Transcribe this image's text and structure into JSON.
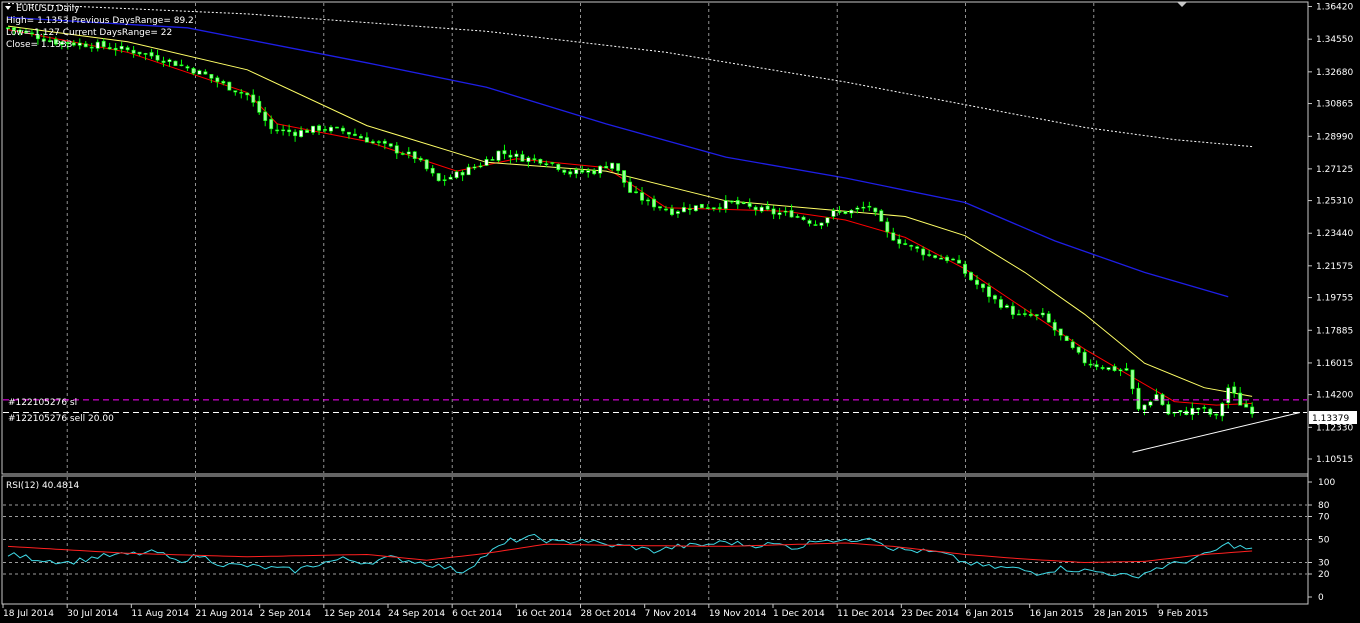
{
  "header": {
    "symbol": "EURUSD,Daily",
    "line1": "High= 1.1353 Previous DaysRange= 89.2",
    "line2": "Low= 1.127 Current DaysRange= 22",
    "line3": "Close= 1.1333"
  },
  "orders": {
    "sl_label": "#122105276 sl",
    "sell_label": "#122105276 sell 20.00",
    "sl_price": 1.139,
    "entry_price": 1.1318
  },
  "price_tag": "1.13379",
  "rsi_label": "RSI(12) 40.4814",
  "colors": {
    "background": "#000000",
    "bull_candle": "#ffffff",
    "bear_candle": "#98ff98",
    "candle_outline": "#00ff00",
    "ma_fast": "#ff0000",
    "ma_mid": "#ffff66",
    "ma_slow": "#1e1ee6",
    "ma_long": "#ffffff",
    "sl_line": "#ff00ff",
    "rsi_main": "#3fd9e6",
    "rsi_signal": "#ff2020",
    "grid": "#cfcfcf"
  },
  "chart_data": [
    {
      "type": "candlestick",
      "symbol": "EURUSD",
      "timeframe": "Daily",
      "x_labels": [
        "18 Jul 2014",
        "30 Jul 2014",
        "11 Aug 2014",
        "21 Aug 2014",
        "2 Sep 2014",
        "12 Sep 2014",
        "24 Sep 2014",
        "6 Oct 2014",
        "16 Oct 2014",
        "28 Oct 2014",
        "7 Nov 2014",
        "19 Nov 2014",
        "1 Dec 2014",
        "11 Dec 2014",
        "23 Dec 2014",
        "6 Jan 2015",
        "16 Jan 2015",
        "28 Jan 2015",
        "9 Feb 2015"
      ],
      "y_ticks": [
        "1.36420",
        "1.34550",
        "1.32680",
        "1.30865",
        "1.28990",
        "1.27125",
        "1.25310",
        "1.23440",
        "1.21575",
        "1.19755",
        "1.17885",
        "1.16015",
        "1.14200",
        "1.12330",
        "1.10515"
      ],
      "ylim": [
        1.1,
        1.3645
      ],
      "close_path": [
        [
          0,
          1.352
        ],
        [
          8,
          1.344
        ],
        [
          15,
          1.342
        ],
        [
          22,
          1.338
        ],
        [
          27,
          1.333
        ],
        [
          33,
          1.325
        ],
        [
          36,
          1.3195
        ],
        [
          40,
          1.3135
        ],
        [
          44,
          1.294
        ],
        [
          48,
          1.292
        ],
        [
          52,
          1.2945
        ],
        [
          56,
          1.293
        ],
        [
          60,
          1.288
        ],
        [
          64,
          1.283
        ],
        [
          68,
          1.278
        ],
        [
          72,
          1.264
        ],
        [
          75,
          1.268
        ],
        [
          79,
          1.274
        ],
        [
          82,
          1.281
        ],
        [
          86,
          1.2775
        ],
        [
          90,
          1.276
        ],
        [
          94,
          1.269
        ],
        [
          98,
          1.27
        ],
        [
          101,
          1.275
        ],
        [
          104,
          1.258
        ],
        [
          107,
          1.252
        ],
        [
          111,
          1.247
        ],
        [
          114,
          1.2495
        ],
        [
          118,
          1.25
        ],
        [
          121,
          1.252
        ],
        [
          124,
          1.249
        ],
        [
          128,
          1.246
        ],
        [
          131,
          1.2455
        ],
        [
          135,
          1.24
        ],
        [
          138,
          1.246
        ],
        [
          141,
          1.247
        ],
        [
          144,
          1.25
        ],
        [
          147,
          1.234
        ],
        [
          150,
          1.228
        ],
        [
          154,
          1.222
        ],
        [
          158,
          1.219
        ],
        [
          161,
          1.208
        ],
        [
          165,
          1.196
        ],
        [
          169,
          1.187
        ],
        [
          173,
          1.187
        ],
        [
          177,
          1.171
        ],
        [
          180,
          1.161
        ],
        [
          184,
          1.157
        ],
        [
          187,
          1.156
        ],
        [
          189,
          1.133
        ],
        [
          192,
          1.142
        ],
        [
          194,
          1.131
        ],
        [
          197,
          1.132
        ],
        [
          199,
          1.1345
        ],
        [
          202,
          1.129
        ],
        [
          204,
          1.146
        ],
        [
          206,
          1.137
        ],
        [
          208,
          1.133
        ]
      ],
      "indicators": [
        {
          "name": "MA fast",
          "color": "#ff0000",
          "values": [
            [
              0,
              1.351
            ],
            [
              20,
              1.338
            ],
            [
              40,
              1.315
            ],
            [
              45,
              1.297
            ],
            [
              60,
              1.287
            ],
            [
              75,
              1.27
            ],
            [
              85,
              1.277
            ],
            [
              100,
              1.272
            ],
            [
              110,
              1.249
            ],
            [
              130,
              1.247
            ],
            [
              140,
              1.242
            ],
            [
              150,
              1.232
            ],
            [
              160,
              1.214
            ],
            [
              170,
              1.191
            ],
            [
              180,
              1.168
            ],
            [
              188,
              1.152
            ],
            [
              195,
              1.138
            ],
            [
              202,
              1.136
            ],
            [
              208,
              1.137
            ]
          ]
        },
        {
          "name": "MA mid",
          "color": "#ffff66",
          "values": [
            [
              0,
              1.353
            ],
            [
              20,
              1.344
            ],
            [
              40,
              1.328
            ],
            [
              60,
              1.296
            ],
            [
              80,
              1.275
            ],
            [
              100,
              1.27
            ],
            [
              120,
              1.253
            ],
            [
              140,
              1.247
            ],
            [
              150,
              1.244
            ],
            [
              160,
              1.233
            ],
            [
              170,
              1.212
            ],
            [
              180,
              1.188
            ],
            [
              190,
              1.16
            ],
            [
              200,
              1.146
            ],
            [
              208,
              1.141
            ]
          ]
        },
        {
          "name": "MA slow",
          "color": "#1e1ee6",
          "values": [
            [
              0,
              1.358
            ],
            [
              30,
              1.352
            ],
            [
              60,
              1.332
            ],
            [
              80,
              1.318
            ],
            [
              100,
              1.297
            ],
            [
              120,
              1.278
            ],
            [
              140,
              1.266
            ],
            [
              160,
              1.252
            ],
            [
              175,
              1.23
            ],
            [
              190,
              1.212
            ],
            [
              204,
              1.198
            ]
          ]
        },
        {
          "name": "MA long",
          "color": "#ffffff",
          "values": [
            [
              0,
              1.366
            ],
            [
              40,
              1.36
            ],
            [
              80,
              1.35
            ],
            [
              110,
              1.338
            ],
            [
              140,
              1.321
            ],
            [
              160,
              1.308
            ],
            [
              180,
              1.295
            ],
            [
              195,
              1.288
            ],
            [
              208,
              1.284
            ]
          ]
        }
      ],
      "trendline": {
        "from": [
          188,
          1.109
        ],
        "to": [
          216,
          1.1318
        ]
      }
    },
    {
      "type": "line",
      "title": "RSI(12) 40.4814",
      "y_ticks": [
        "100",
        "80",
        "70",
        "50",
        "30",
        "20",
        "0"
      ],
      "ylim": [
        0,
        100
      ],
      "series": [
        {
          "name": "RSI(12)",
          "color": "#3fd9e6",
          "values": [
            [
              0,
              37
            ],
            [
              5,
              33
            ],
            [
              10,
              30
            ],
            [
              15,
              35
            ],
            [
              20,
              37
            ],
            [
              25,
              39
            ],
            [
              28,
              31
            ],
            [
              32,
              36
            ],
            [
              36,
              28
            ],
            [
              40,
              27
            ],
            [
              44,
              25
            ],
            [
              48,
              23
            ],
            [
              52,
              29
            ],
            [
              56,
              33
            ],
            [
              60,
              30
            ],
            [
              64,
              34
            ],
            [
              68,
              31
            ],
            [
              72,
              27
            ],
            [
              76,
              22
            ],
            [
              80,
              37
            ],
            [
              84,
              49
            ],
            [
              88,
              52
            ],
            [
              92,
              47
            ],
            [
              96,
              50
            ],
            [
              100,
              45
            ],
            [
              104,
              44
            ],
            [
              108,
              40
            ],
            [
              112,
              44
            ],
            [
              116,
              45
            ],
            [
              120,
              48
            ],
            [
              124,
              45
            ],
            [
              128,
              46
            ],
            [
              132,
              43
            ],
            [
              136,
              51
            ],
            [
              140,
              48
            ],
            [
              144,
              53
            ],
            [
              148,
              42
            ],
            [
              152,
              40
            ],
            [
              156,
              38
            ],
            [
              160,
              30
            ],
            [
              164,
              26
            ],
            [
              168,
              25
            ],
            [
              172,
              21
            ],
            [
              176,
              25
            ],
            [
              180,
              23
            ],
            [
              184,
              21
            ],
            [
              188,
              17
            ],
            [
              192,
              25
            ],
            [
              196,
              30
            ],
            [
              200,
              36
            ],
            [
              204,
              46
            ],
            [
              208,
              41
            ]
          ]
        },
        {
          "name": "Signal",
          "color": "#ff2020",
          "values": [
            [
              0,
              44
            ],
            [
              20,
              38
            ],
            [
              40,
              35
            ],
            [
              60,
              37
            ],
            [
              70,
              32
            ],
            [
              80,
              38
            ],
            [
              90,
              46
            ],
            [
              100,
              45
            ],
            [
              120,
              44
            ],
            [
              140,
              47
            ],
            [
              148,
              44
            ],
            [
              160,
              37
            ],
            [
              170,
              33
            ],
            [
              180,
              30
            ],
            [
              190,
              31
            ],
            [
              200,
              37
            ],
            [
              208,
              40
            ]
          ]
        }
      ]
    }
  ]
}
